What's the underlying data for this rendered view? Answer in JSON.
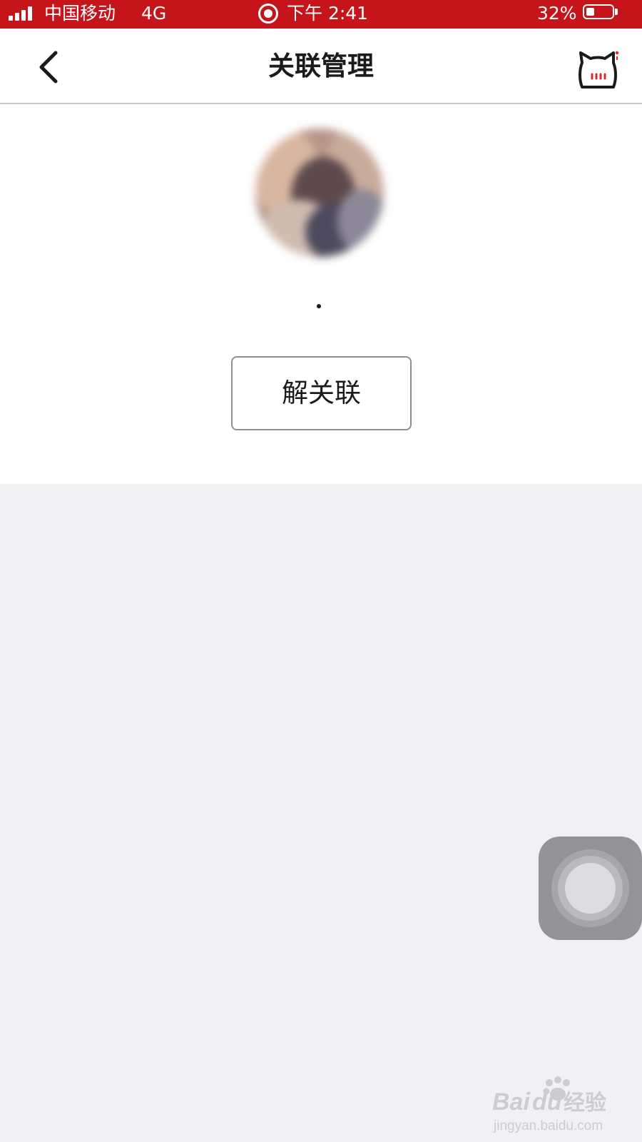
{
  "status_bar": {
    "carrier": "中国移动",
    "network": "4G",
    "time": "下午 2:41",
    "battery_percent_text": "32%",
    "battery_level": 0.32,
    "signal_bars": 4
  },
  "nav": {
    "title": "关联管理",
    "back_icon": "chevron-left-icon",
    "right_icon": "cat-face-icon"
  },
  "profile": {
    "name": "·"
  },
  "actions": {
    "unlink_label": "解关联"
  },
  "colors": {
    "status_bar": "#c5141a",
    "page_background": "#f1f0f3",
    "card_background": "#ffffff",
    "text": "#1b1b1b",
    "button_border": "#8f8f92"
  },
  "watermark": {
    "logo_text": "Baidu经验",
    "url": "jingyan.baidu.com"
  }
}
